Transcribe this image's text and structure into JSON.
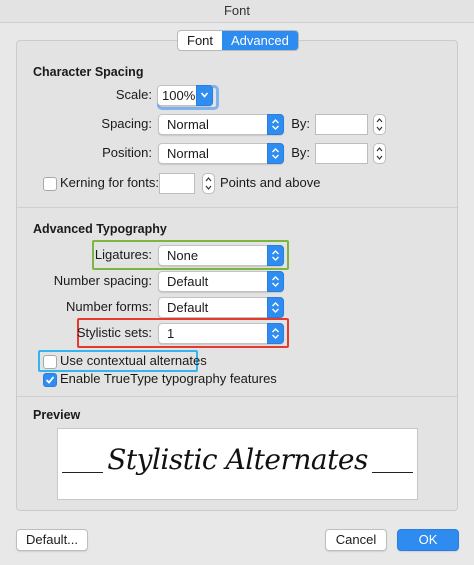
{
  "window": {
    "title": "Font"
  },
  "tabs": [
    {
      "label": "Font",
      "selected": false
    },
    {
      "label": "Advanced",
      "selected": true
    }
  ],
  "character_spacing": {
    "title": "Character Spacing",
    "scale_label": "Scale:",
    "scale_value": "100%",
    "spacing_label": "Spacing:",
    "spacing_value": "Normal",
    "spacing_by_label": "By:",
    "spacing_by_value": "",
    "position_label": "Position:",
    "position_value": "Normal",
    "position_by_label": "By:",
    "position_by_value": "",
    "kerning_label": "Kerning for fonts:",
    "kerning_checked": false,
    "kerning_value": "",
    "kerning_suffix": "Points and above"
  },
  "advanced_typography": {
    "title": "Advanced Typography",
    "ligatures_label": "Ligatures:",
    "ligatures_value": "None",
    "number_spacing_label": "Number spacing:",
    "number_spacing_value": "Default",
    "number_forms_label": "Number forms:",
    "number_forms_value": "Default",
    "stylistic_sets_label": "Stylistic sets:",
    "stylistic_sets_value": "1",
    "contextual_label": "Use contextual alternates",
    "contextual_checked": false,
    "truetype_label": "Enable TrueType typography features",
    "truetype_checked": true
  },
  "preview": {
    "title": "Preview",
    "sample_text": "Stylistic Alternates"
  },
  "footer": {
    "default_label": "Default...",
    "cancel_label": "Cancel",
    "ok_label": "OK"
  },
  "colors": {
    "accent": "#2e8bf0",
    "highlight_green": "#7bb640",
    "highlight_red": "#e63a2e",
    "highlight_blue": "#36b4f0"
  }
}
